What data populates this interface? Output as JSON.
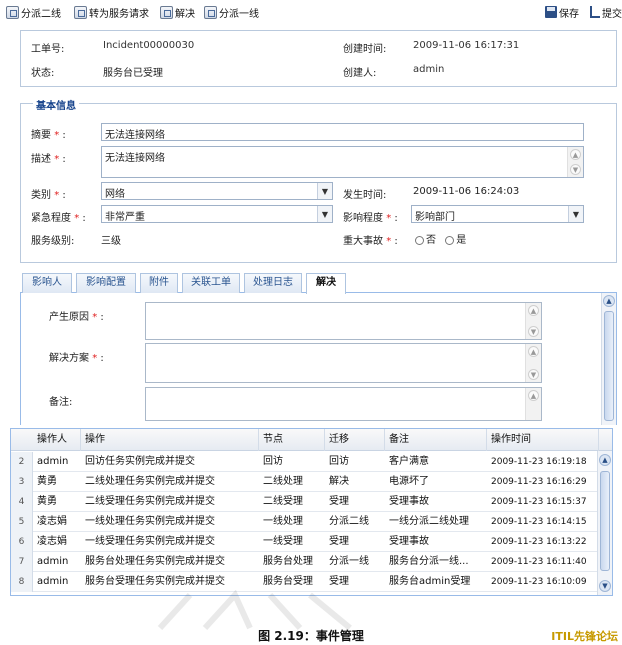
{
  "toolbar": {
    "dispatch_second": "分派二线",
    "convert_service": "转为服务请求",
    "resolve": "解决",
    "dispatch_first": "分派一线",
    "save": "保存",
    "submit": "提交"
  },
  "header": {
    "ticket_label": "工单号:",
    "ticket_value": "Incident00000030",
    "created_time_label": "创建时间:",
    "created_time_value": "2009-11-06 16:17:31",
    "status_label": "状态:",
    "status_value": "服务台已受理",
    "creator_label": "创建人:",
    "creator_value": "admin"
  },
  "basic": {
    "legend": "基本信息",
    "summary_label": "摘要",
    "summary_value": "无法连接网络",
    "desc_label": "描述",
    "desc_value": "无法连接网络",
    "category_label": "类别",
    "category_value": "网络",
    "occur_label": "发生时间:",
    "occur_value": "2009-11-06 16:24:03",
    "urgency_label": "紧急程度",
    "urgency_value": "非常严重",
    "impact_label": "影响程度",
    "impact_value": "影响部门",
    "sla_label": "服务级别:",
    "sla_value": "三级",
    "major_label": "重大事故",
    "major_no": "否",
    "major_yes": "是",
    "required_mark": "*",
    "colon": ":"
  },
  "tabs": [
    "影响人",
    "影响配置",
    "附件",
    "关联工单",
    "处理日志",
    "解决"
  ],
  "resolve_form": {
    "cause_label": "产生原因",
    "solution_label": "解决方案",
    "remark_label": "备注:"
  },
  "grid": {
    "columns": [
      "操作人",
      "操作",
      "节点",
      "迁移",
      "备注",
      "操作时间"
    ],
    "rows": [
      {
        "num": "2",
        "user": "admin",
        "action": "回访任务实例完成并提交",
        "node": "回访",
        "trans": "回访",
        "remark": "客户满意",
        "time": "2009-11-23 16:19:18"
      },
      {
        "num": "3",
        "user": "黄勇",
        "action": "二线处理任务实例完成并提交",
        "node": "二线处理",
        "trans": "解决",
        "remark": "电源坏了",
        "time": "2009-11-23 16:16:29"
      },
      {
        "num": "4",
        "user": "黄勇",
        "action": "二线受理任务实例完成并提交",
        "node": "二线受理",
        "trans": "受理",
        "remark": "受理事故",
        "time": "2009-11-23 16:15:37"
      },
      {
        "num": "5",
        "user": "凌志娟",
        "action": "一线处理任务实例完成并提交",
        "node": "一线处理",
        "trans": "分派二线",
        "remark": "一线分派二线处理",
        "time": "2009-11-23 16:14:15"
      },
      {
        "num": "6",
        "user": "凌志娟",
        "action": "一线受理任务实例完成并提交",
        "node": "一线受理",
        "trans": "受理",
        "remark": "受理事故",
        "time": "2009-11-23 16:13:22"
      },
      {
        "num": "7",
        "user": "admin",
        "action": "服务台处理任务实例完成并提交",
        "node": "服务台处理",
        "trans": "分派一线",
        "remark": "服务台分派一线...",
        "time": "2009-11-23 16:11:40"
      },
      {
        "num": "8",
        "user": "admin",
        "action": "服务台受理任务实例完成并提交",
        "node": "服务台受理",
        "trans": "受理",
        "remark": "服务台admin受理",
        "time": "2009-11-23 16:10:09"
      }
    ]
  },
  "caption": "图 2.19：事件管理",
  "brand": "ITIL先锋论坛"
}
